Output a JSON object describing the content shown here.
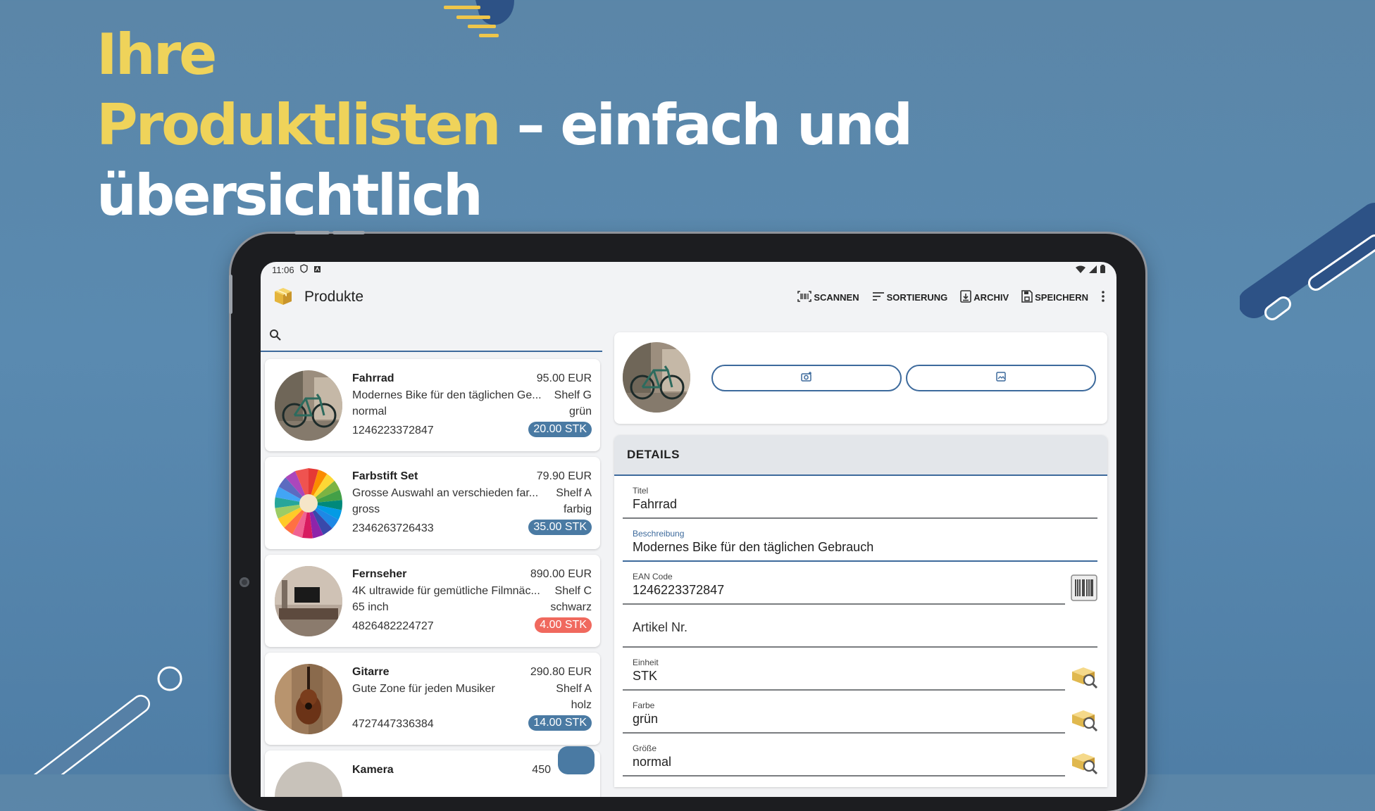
{
  "headline": {
    "line1": "Ihre",
    "line2_highlight": "Produktlisten",
    "line2_rest": " – einfach und",
    "line3": "übersichtlich"
  },
  "status_bar": {
    "time": "11:06"
  },
  "app_bar": {
    "title": "Produkte",
    "actions": [
      "SCANNEN",
      "SORTIERUNG",
      "ARCHIV",
      "SPEICHERN"
    ],
    "icons": [
      "box-icon",
      "barcode-scan-icon",
      "sort-icon",
      "archive-icon",
      "save-icon",
      "more-vert-icon"
    ]
  },
  "products": [
    {
      "name": "Fahrrad",
      "description": "Modernes Bike für den täglichen Ge...",
      "size": "normal",
      "ean": "1246223372847",
      "price": "95.00 EUR",
      "shelf": "Shelf G",
      "color": "grün",
      "stock": "20.00 STK",
      "stock_status": "ok"
    },
    {
      "name": "Farbstift Set",
      "description": "Grosse Auswahl an verschieden far...",
      "size": "gross",
      "ean": "2346263726433",
      "price": "79.90 EUR",
      "shelf": "Shelf A",
      "color": "farbig",
      "stock": "35.00 STK",
      "stock_status": "ok"
    },
    {
      "name": "Fernseher",
      "description": "4K ultrawide für gemütliche Filmnäc...",
      "size": "65 inch",
      "ean": "4826482224727",
      "price": "890.00 EUR",
      "shelf": "Shelf C",
      "color": "schwarz",
      "stock": "4.00 STK",
      "stock_status": "low"
    },
    {
      "name": "Gitarre",
      "description": "Gute Zone für jeden Musiker",
      "size": "",
      "ean": "4727447336384",
      "price": "290.80 EUR",
      "shelf": "Shelf A",
      "color": "holz",
      "stock": "14.00 STK",
      "stock_status": "ok"
    },
    {
      "name": "Kamera",
      "price": "450"
    }
  ],
  "details": {
    "header": "DETAILS",
    "fields": [
      {
        "label": "Titel",
        "value": "Fahrrad"
      },
      {
        "label": "Beschreibung",
        "value": "Modernes Bike für den täglichen Gebrauch"
      },
      {
        "label": "EAN Code",
        "value": "1246223372847"
      },
      {
        "label": "",
        "placeholder": "Artikel Nr."
      },
      {
        "label": "Einheit",
        "value": "STK"
      },
      {
        "label": "Farbe",
        "value": "grün"
      },
      {
        "label": "Größe",
        "value": "normal"
      }
    ]
  },
  "colors": {
    "accent": "#3d6a9c",
    "badge_ok": "#4a7aa3",
    "badge_low": "#f0695e",
    "headline_highlight": "#efd35a",
    "background": "#5a8ab0"
  }
}
